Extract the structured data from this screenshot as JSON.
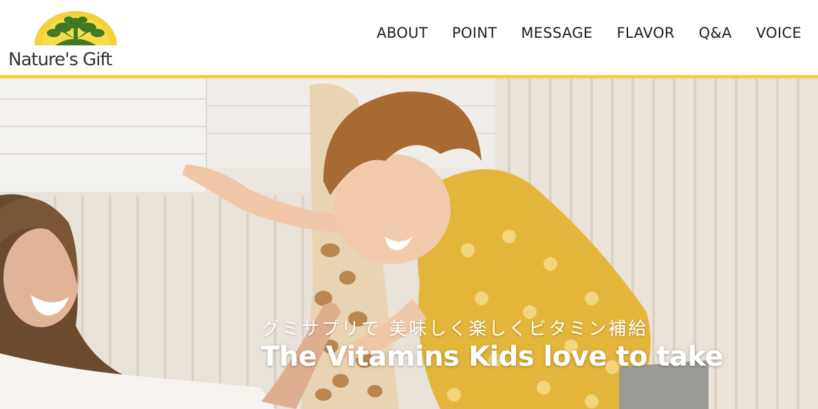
{
  "brand": {
    "name": "Nature's Gift",
    "logo_icon": "sun-tree-icon",
    "colors": {
      "yellow": "#f3d13b",
      "green": "#3f7a22",
      "text": "#333333"
    }
  },
  "nav": {
    "items": [
      {
        "label": "ABOUT"
      },
      {
        "label": "POINT"
      },
      {
        "label": "MESSAGE"
      },
      {
        "label": "FLAVOR"
      },
      {
        "label": "Q&A"
      },
      {
        "label": "VOICE"
      }
    ]
  },
  "hero": {
    "subtitle": "グミサプリで 美味しく楽しくビタミン補給",
    "title": "The Vitamins Kids love to take"
  }
}
